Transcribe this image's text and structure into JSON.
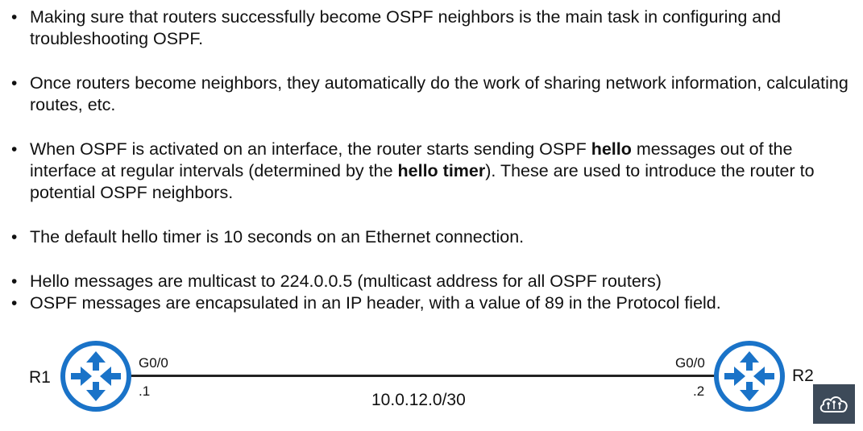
{
  "bullets": {
    "b1": "Making sure that routers successfully become OSPF neighbors is the main task in configuring and troubleshooting OSPF.",
    "b2": "Once routers become neighbors, they automatically do the work of sharing network information, calculating routes, etc.",
    "b3": {
      "p1": "When OSPF is activated on an interface, the router starts sending OSPF ",
      "bold1": "hello",
      "p2": " messages out of the interface at regular intervals (determined by the ",
      "bold2": "hello timer",
      "p3": ").  These are used to introduce the router to potential OSPF neighbors."
    },
    "b4": "The default hello timer is 10 seconds on an Ethernet connection.",
    "b5": "Hello messages are multicast to 224.0.0.5 (multicast address for all OSPF routers)",
    "b6": "OSPF messages are encapsulated in an IP header, with a value of 89 in the Protocol field."
  },
  "diagram": {
    "r1": {
      "name": "R1",
      "interface": "G0/0",
      "address": ".1"
    },
    "r2": {
      "name": "R2",
      "interface": "G0/0",
      "address": ".2"
    },
    "network": "10.0.12.0/30",
    "router_color": "#1a73c8",
    "router_icon": "router-icon"
  },
  "badge": {
    "icon": "cloud-network-icon",
    "color": "#3d4a59"
  }
}
